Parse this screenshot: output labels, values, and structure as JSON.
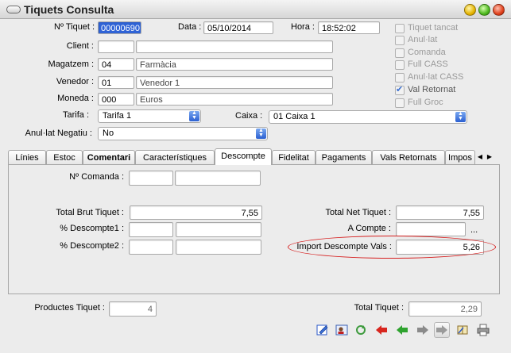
{
  "window": {
    "title": "Tiquets Consulta"
  },
  "header": {
    "ticket_label": "Nº Tiquet :",
    "ticket_value": "00000690",
    "date_label": "Data :",
    "date_value": "05/10/2014",
    "hour_label": "Hora :",
    "hour_value": "18:52:02",
    "client_label": "Client :",
    "client_code": "",
    "client_name": "",
    "store_label": "Magatzem :",
    "store_code": "04",
    "store_name": "Farmàcia",
    "seller_label": "Venedor :",
    "seller_code": "01",
    "seller_name": "Venedor 1",
    "currency_label": "Moneda :",
    "currency_code": "000",
    "currency_name": "Euros",
    "rate_label": "Tarifa :",
    "rate_value": "Tarifa 1",
    "cash_label": "Caixa :",
    "cash_value": "01 Caixa 1",
    "annulled_label": "Anul·lat Negatiu :",
    "annulled_value": "No"
  },
  "flags": [
    {
      "label": "Tiquet tancat",
      "checked": false
    },
    {
      "label": "Anul·lat",
      "checked": false
    },
    {
      "label": "Comanda",
      "checked": false
    },
    {
      "label": "Full CASS",
      "checked": false
    },
    {
      "label": "Anul·lat CASS",
      "checked": false
    },
    {
      "label": "Val Retornat",
      "checked": true
    },
    {
      "label": "Full Groc",
      "checked": false
    }
  ],
  "tabs": [
    {
      "label": "Línies"
    },
    {
      "label": "Estoc"
    },
    {
      "label": "Comentari"
    },
    {
      "label": "Característiques"
    },
    {
      "label": "Descompte"
    },
    {
      "label": "Fidelitat"
    },
    {
      "label": "Pagaments"
    },
    {
      "label": "Vals Retornats"
    },
    {
      "label": "Impos"
    }
  ],
  "discount": {
    "order_label": "Nº Comanda :",
    "gross_label": "Total Brut Tiquet :",
    "gross_value": "7,55",
    "net_label": "Total Net Tiquet :",
    "net_value": "7,55",
    "disc1_label": "% Descompte1 :",
    "deposit_label": "A Compte :",
    "deposit_dots": "...",
    "disc2_label": "% Descompte2 :",
    "voucher_label": "Import Descompte Vals :",
    "voucher_value": "5,26"
  },
  "footer": {
    "products_label": "Productes Tiquet :",
    "products_value": "4",
    "total_label": "Total Tiquet :",
    "total_value": "2,29"
  },
  "toolbar": [
    "edit-icon",
    "contact-card-icon",
    "refresh-icon",
    "arrow-left-red-icon",
    "arrow-left-green-icon",
    "arrow-right-gray-icon",
    "arrow-right-pressed-icon",
    "notebook-icon",
    "printer-icon"
  ],
  "colors": {
    "selection": "#2f63d6",
    "highlight_ellipse": "#d62020"
  }
}
